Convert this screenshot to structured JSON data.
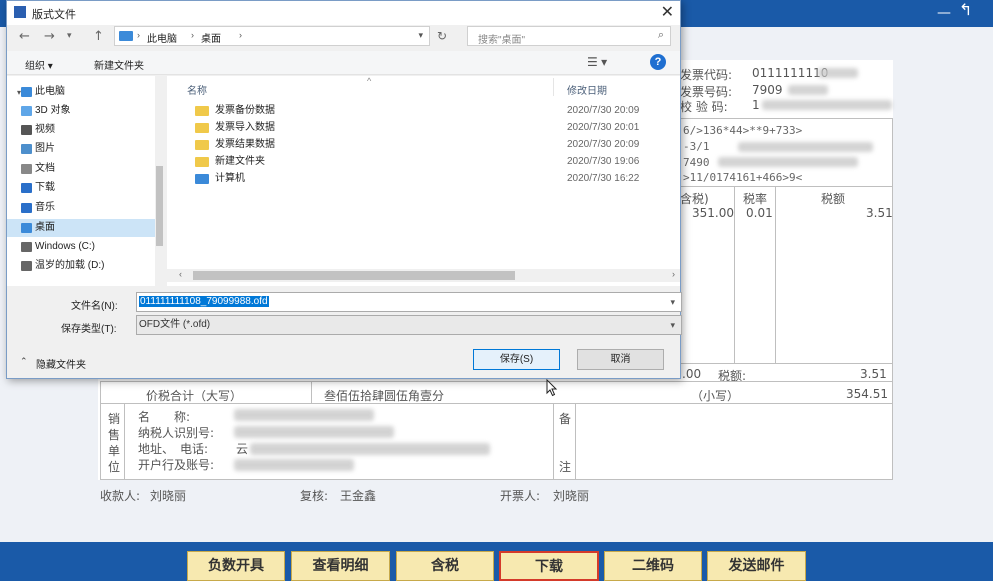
{
  "background_app": {
    "action_buttons": [
      {
        "label": "负数开具"
      },
      {
        "label": "查看明细"
      },
      {
        "label": "含税"
      },
      {
        "label": "下载",
        "selected": true
      },
      {
        "label": "二维码"
      },
      {
        "label": "发送邮件"
      }
    ],
    "invoice": {
      "code_label": "发票代码:",
      "code_value": "0111111110",
      "number_label": "发票号码:",
      "number_value": "7909",
      "check_label": "校 验 码:",
      "check_value": "1",
      "cipher_lines": [
        "6/>136*44>**9+733>",
        "-3/1",
        "7490",
        ">11/0174161+466>9<"
      ],
      "col_tax_included": "含税)",
      "col_rate": "税率",
      "col_tax": "税额",
      "row_amount": "351.00",
      "row_rate": "0.01",
      "row_tax": "3.51",
      "subtotal_amount": ".00",
      "subtotal_tax_label": "税额:",
      "subtotal_tax": "3.51",
      "total_label": "价税合计（大写）",
      "total_words": "叁佰伍拾肆圆伍角壹分",
      "total_small_label": "（小写）",
      "total_small": "354.51",
      "seller_side_label": [
        "销",
        "售",
        "单",
        "位"
      ],
      "seller_fields": [
        "名　　称:",
        "纳税人识别号:",
        "地址、　电话:",
        "开户行及账号:"
      ],
      "seller_phone_partial": "云",
      "remarks_label": [
        "备",
        "注"
      ],
      "payee_label": "收款人:",
      "payee": "刘晓丽",
      "reviewer_label": "复核:",
      "reviewer": "王金鑫",
      "issuer_label": "开票人:",
      "issuer": "刘晓丽"
    }
  },
  "dialog": {
    "title": "版式文件",
    "address": {
      "segments": [
        "此电脑",
        "桌面"
      ]
    },
    "search_placeholder": "搜索\"桌面\"",
    "toolbar": {
      "organize": "组织 ▾",
      "new_folder": "新建文件夹"
    },
    "nav_items": [
      {
        "label": "此电脑",
        "color": "#3b8ad9"
      },
      {
        "label": "3D 对象",
        "color": "#5fa6e8"
      },
      {
        "label": "视频",
        "color": "#555555"
      },
      {
        "label": "图片",
        "color": "#4d8fcc"
      },
      {
        "label": "文档",
        "color": "#888888"
      },
      {
        "label": "下载",
        "color": "#2a6fc9"
      },
      {
        "label": "音乐",
        "color": "#2a6fc9"
      },
      {
        "label": "桌面",
        "color": "#3b8ad9",
        "selected": true
      },
      {
        "label": "Windows (C:)",
        "color": "#666666"
      },
      {
        "label": "温岁的加载 (D:)",
        "color": "#666666"
      }
    ],
    "columns": {
      "name": "名称",
      "date": "修改日期"
    },
    "files": [
      {
        "name": "发票备份数据",
        "date": "2020/7/30 20:09",
        "type": "folder"
      },
      {
        "name": "发票导入数据",
        "date": "2020/7/30 20:01",
        "type": "folder"
      },
      {
        "name": "发票结果数据",
        "date": "2020/7/30 20:09",
        "type": "folder"
      },
      {
        "name": "新建文件夹",
        "date": "2020/7/30 19:06",
        "type": "folder"
      },
      {
        "name": "计算机",
        "date": "2020/7/30 16:22",
        "type": "computer"
      }
    ],
    "filename_label": "文件名(N):",
    "filename_value": "011111111108_79099988.ofd",
    "filetype_label": "保存类型(T):",
    "filetype_value": "OFD文件 (*.ofd)",
    "hide_folders": "隐藏文件夹",
    "save_button": "保存(S)",
    "cancel_button": "取消"
  },
  "colors": {
    "app_blue": "#1a5aa8",
    "button_yellow": "#f7e9b0",
    "selected_red": "#d43a2a",
    "selection_blue": "#0078d7"
  }
}
